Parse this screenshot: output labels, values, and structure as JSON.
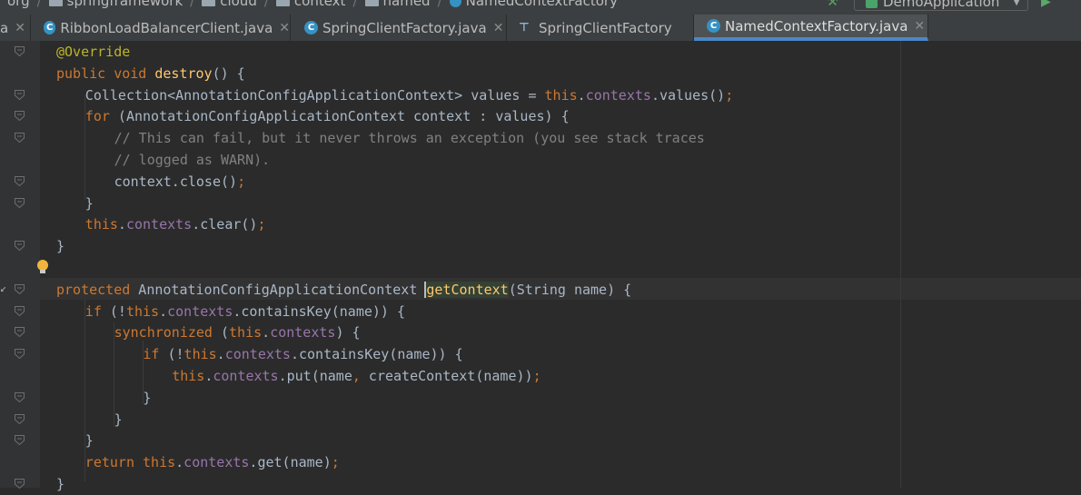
{
  "breadcrumb": {
    "items": [
      "org",
      "springframework",
      "cloud",
      "context",
      "named",
      "NamedContextFactory"
    ]
  },
  "run_config": {
    "label": "DemoApplication"
  },
  "tabs": [
    {
      "label": "RibbonLoadBalancerClient.java",
      "icon": "class-icon",
      "closable": true
    },
    {
      "label": "SpringClientFactory.java",
      "icon": "class-icon",
      "closable": true
    },
    {
      "label": "SpringClientFactory",
      "icon": "structure-icon",
      "closable": false
    },
    {
      "label": "NamedContextFactory.java",
      "icon": "class-icon",
      "closable": true,
      "active": true
    }
  ],
  "code": {
    "lines": [
      {
        "indent": 0,
        "tokens": [
          [
            "ann",
            "@Override"
          ]
        ]
      },
      {
        "indent": 0,
        "tokens": [
          [
            "kw",
            "public"
          ],
          [
            "p",
            " "
          ],
          [
            "kw",
            "void"
          ],
          [
            "p",
            " "
          ],
          [
            "fn",
            "destroy"
          ],
          [
            "p",
            "() {"
          ]
        ]
      },
      {
        "indent": 1,
        "tokens": [
          [
            "p",
            "Collection<AnnotationConfigApplicationContext> values = "
          ],
          [
            "kw",
            "this"
          ],
          [
            "p",
            "."
          ],
          [
            "fld",
            "contexts"
          ],
          [
            "p",
            ".values()"
          ],
          [
            "punct",
            ";"
          ]
        ]
      },
      {
        "indent": 1,
        "tokens": [
          [
            "kw",
            "for"
          ],
          [
            "p",
            " (AnnotationConfigApplicationContext context : values) {"
          ]
        ]
      },
      {
        "indent": 2,
        "tokens": [
          [
            "cmt",
            "// This can fail, but it never throws an exception (you see stack traces"
          ]
        ]
      },
      {
        "indent": 2,
        "tokens": [
          [
            "cmt",
            "// logged as WARN)."
          ]
        ]
      },
      {
        "indent": 2,
        "tokens": [
          [
            "p",
            "context.close()"
          ],
          [
            "punct",
            ";"
          ]
        ]
      },
      {
        "indent": 1,
        "tokens": [
          [
            "p",
            "}"
          ]
        ]
      },
      {
        "indent": 1,
        "tokens": [
          [
            "kw",
            "this"
          ],
          [
            "p",
            "."
          ],
          [
            "fld",
            "contexts"
          ],
          [
            "p",
            ".clear()"
          ],
          [
            "punct",
            ";"
          ]
        ]
      },
      {
        "indent": 0,
        "tokens": [
          [
            "p",
            "}"
          ]
        ]
      },
      {
        "indent": 0,
        "tokens": []
      },
      {
        "indent": 0,
        "tokens": [
          [
            "kw",
            "protected"
          ],
          [
            "p",
            " AnnotationConfigApplicationContext "
          ],
          [
            "caret",
            ""
          ],
          [
            "hlfn",
            "getContext"
          ],
          [
            "p",
            "(String name) {"
          ]
        ]
      },
      {
        "indent": 1,
        "tokens": [
          [
            "kw",
            "if"
          ],
          [
            "p",
            " (!"
          ],
          [
            "kw",
            "this"
          ],
          [
            "p",
            "."
          ],
          [
            "fld",
            "contexts"
          ],
          [
            "p",
            ".containsKey(name)) {"
          ]
        ]
      },
      {
        "indent": 2,
        "tokens": [
          [
            "kw",
            "synchronized"
          ],
          [
            "p",
            " ("
          ],
          [
            "kw",
            "this"
          ],
          [
            "p",
            "."
          ],
          [
            "fld",
            "contexts"
          ],
          [
            "p",
            ") {"
          ]
        ]
      },
      {
        "indent": 3,
        "tokens": [
          [
            "kw",
            "if"
          ],
          [
            "p",
            " (!"
          ],
          [
            "kw",
            "this"
          ],
          [
            "p",
            "."
          ],
          [
            "fld",
            "contexts"
          ],
          [
            "p",
            ".containsKey(name)) {"
          ]
        ]
      },
      {
        "indent": 4,
        "tokens": [
          [
            "kw",
            "this"
          ],
          [
            "p",
            "."
          ],
          [
            "fld",
            "contexts"
          ],
          [
            "p",
            ".put(name"
          ],
          [
            "punct",
            ","
          ],
          [
            "p",
            " createContext(name))"
          ],
          [
            "punct",
            ";"
          ]
        ]
      },
      {
        "indent": 3,
        "tokens": [
          [
            "p",
            "}"
          ]
        ]
      },
      {
        "indent": 2,
        "tokens": [
          [
            "p",
            "}"
          ]
        ]
      },
      {
        "indent": 1,
        "tokens": [
          [
            "p",
            "}"
          ]
        ]
      },
      {
        "indent": 1,
        "tokens": [
          [
            "kw",
            "return"
          ],
          [
            "p",
            " "
          ],
          [
            "kw",
            "this"
          ],
          [
            "p",
            "."
          ],
          [
            "fld",
            "contexts"
          ],
          [
            "p",
            ".get(name)"
          ],
          [
            "punct",
            ";"
          ]
        ]
      },
      {
        "indent": 0,
        "tokens": [
          [
            "p",
            "}"
          ]
        ]
      }
    ]
  }
}
